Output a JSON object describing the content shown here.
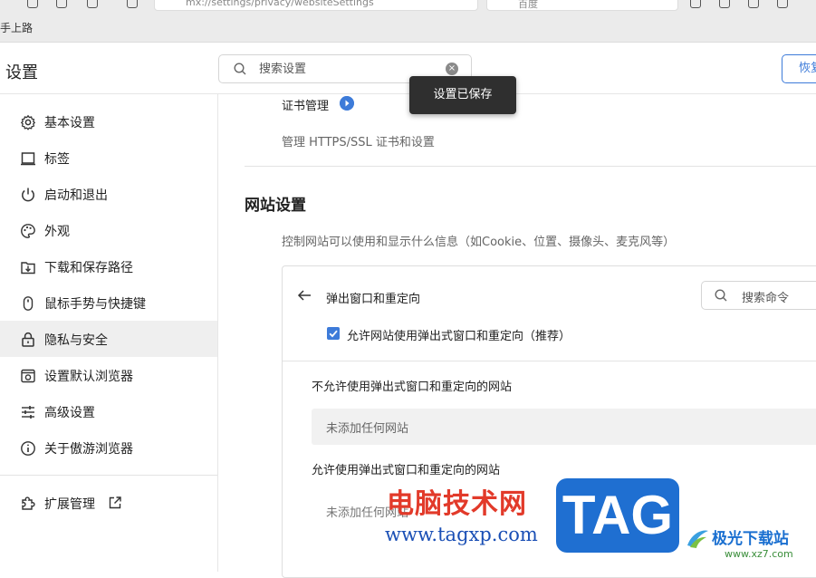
{
  "browser": {
    "url": "mx://settings/privacy/websiteSettings",
    "search_placeholder": "百度",
    "bookmark": "手上路"
  },
  "header": {
    "title": "设置",
    "search_placeholder": "搜索设置",
    "restore_label": "恢复"
  },
  "toast": "设置已保存",
  "sidebar": {
    "items": [
      {
        "label": "基本设置",
        "icon": "gear-icon"
      },
      {
        "label": "标签",
        "icon": "tab-icon"
      },
      {
        "label": "启动和退出",
        "icon": "power-icon"
      },
      {
        "label": "外观",
        "icon": "palette-icon"
      },
      {
        "label": "下载和保存路径",
        "icon": "download-icon"
      },
      {
        "label": "鼠标手势与快捷键",
        "icon": "mouse-icon"
      },
      {
        "label": "隐私与安全",
        "icon": "lock-icon",
        "active": true
      },
      {
        "label": "设置默认浏览器",
        "icon": "browser-icon"
      },
      {
        "label": "高级设置",
        "icon": "sliders-icon"
      },
      {
        "label": "关于傲游浏览器",
        "icon": "info-icon"
      }
    ],
    "extensions": {
      "label": "扩展管理",
      "icon": "puzzle-icon"
    }
  },
  "content": {
    "cert_title": "证书管理",
    "cert_desc": "管理 HTTPS/SSL 证书和设置",
    "site_title": "网站设置",
    "site_desc": "控制网站可以使用和显示什么信息（如Cookie、位置、摄像头、麦克风等）",
    "panel": {
      "title": "弹出窗口和重定向",
      "search_placeholder": "搜索命令",
      "checkbox_label": "允许网站使用弹出式窗口和重定向（推荐）",
      "checkbox_checked": true,
      "block_title": "不允许使用弹出式窗口和重定向的网站",
      "block_empty": "未添加任何网站",
      "allow_title": "允许使用弹出式窗口和重定向的网站",
      "allow_empty": "未添加任何网站"
    }
  },
  "watermark": {
    "cn": "电脑技术网",
    "url": "www.tagxp.com",
    "tag": "TAG",
    "jg": "极光下载站",
    "jg_url": "www.xz7.com"
  },
  "colors": {
    "accent": "#3d7bd9",
    "active_bg": "#efefef",
    "toast_bg": "#2f2f2f"
  }
}
